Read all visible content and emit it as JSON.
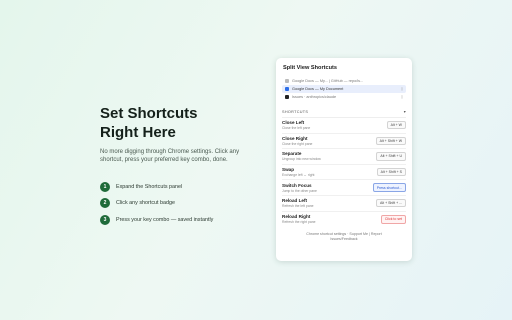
{
  "hero": {
    "title_line1": "Set Shortcuts",
    "title_line2": "Right Here",
    "lead": "No more digging through Chrome settings. Click any shortcut, press your preferred key combo, done.",
    "steps": [
      {
        "num": "1",
        "text": "Expand the Shortcuts panel"
      },
      {
        "num": "2",
        "text": "Click any shortcut badge"
      },
      {
        "num": "3",
        "text": "Press your key combo — saved instantly"
      }
    ]
  },
  "panel": {
    "title": "Split View Shortcuts",
    "tabs": [
      {
        "label": "Google Docs — My... | GitHub — repo/is...",
        "end": ""
      },
      {
        "label": "Google Docs — My Document",
        "end": "▯"
      },
      {
        "label": "Issues · anthropics/claude",
        "end": "▯"
      }
    ],
    "section_label": "SHORTCUTS",
    "section_chevron": "▾",
    "shortcuts": [
      {
        "name": "Close Left",
        "desc": "Close the left pane",
        "badge": "Alt + W"
      },
      {
        "name": "Close Right",
        "desc": "Close the right pane",
        "badge": "Alt + Shift + W"
      },
      {
        "name": "Separate",
        "desc": "Ungroup into new window",
        "badge": "Alt + Shift + U"
      },
      {
        "name": "Swap",
        "desc": "Exchange left ↔ right",
        "badge": "Alt + Shift + S"
      },
      {
        "name": "Switch Focus",
        "desc": "Jump to the other pane",
        "badge": "Press shortcut..."
      },
      {
        "name": "Reload Left",
        "desc": "Refresh the left pane",
        "badge": "Alt + Shift + ..."
      },
      {
        "name": "Reload Right",
        "desc": "Refresh the right pane",
        "badge": "Click to set"
      }
    ],
    "footer_line1": "Chrome shortcut settings · Support Me | Report",
    "footer_line2": "Issues/Feedback"
  },
  "colors": {
    "accent": "#1f6b3a",
    "focus": "#2d5bd0",
    "danger": "#d33333"
  }
}
